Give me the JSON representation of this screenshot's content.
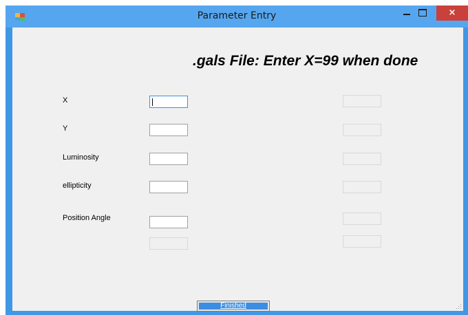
{
  "window": {
    "title": "Parameter Entry",
    "close_glyph": "×",
    "icons": [
      "app-icon",
      "minimize-icon",
      "maximize-icon",
      "close-icon"
    ]
  },
  "form": {
    "heading": ".gals File: Enter X=99 when done",
    "fields": [
      {
        "label": "X",
        "value": ""
      },
      {
        "label": "Y",
        "value": ""
      },
      {
        "label": "Luminosity",
        "value": ""
      },
      {
        "label": "ellipticity",
        "value": ""
      },
      {
        "label": "Position Angle",
        "value": ""
      }
    ],
    "finish_button": "Finished"
  },
  "colors": {
    "titlebar": "#56a6ef",
    "close_button": "#c9413a",
    "button_fill": "#3a8de0",
    "client_bg": "#f0f0f0"
  }
}
